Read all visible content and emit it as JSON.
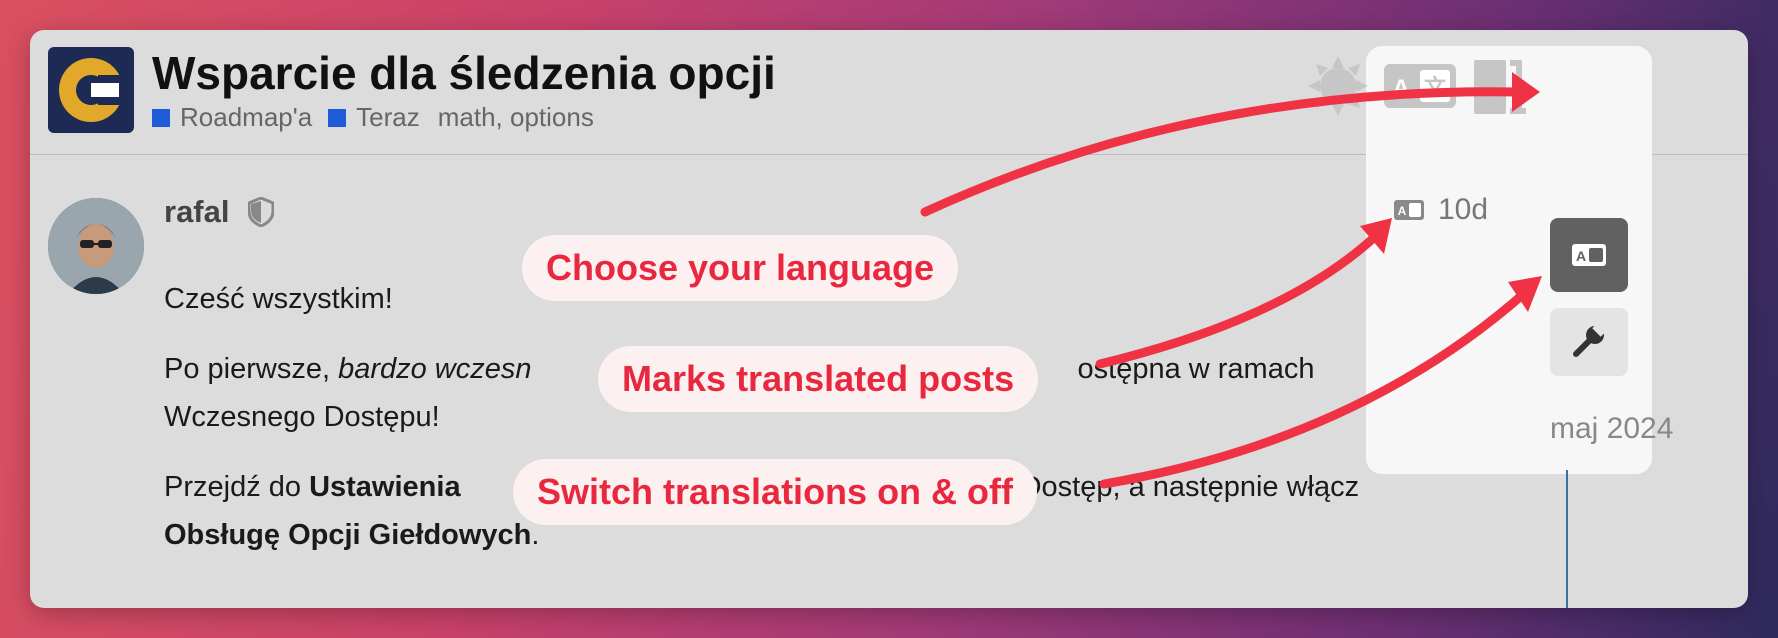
{
  "topic": {
    "title": "Wsparcie dla śledzenia opcji",
    "categories": [
      {
        "name": "Roadmap'a",
        "color": "#1f5bd6"
      },
      {
        "name": "Teraz",
        "color": "#1f5bd6"
      }
    ],
    "tags": "math, options"
  },
  "header_icons": [
    "sun-icon",
    "translate-icon",
    "logout-door-icon"
  ],
  "post": {
    "username": "rafal",
    "time": "10d",
    "greeting": "Cześć wszystkim!",
    "p2_prefix": "Po pierwsze, ",
    "p2_italic": "bardzo wczesn",
    "p2_suffix": "ostępna w ramach",
    "p2_line2": "Wczesnego Dostępu!",
    "p3_prefix": "Przejdź do ",
    "p3_bold": "Ustawienia",
    "p3_suffix": "Dostęp, a następnie włącz",
    "p3_bold2": "Obsługę Opcji Giełdowych",
    "p3_end": "."
  },
  "timeline": {
    "date": "maj 2024"
  },
  "annotations": {
    "language": "Choose your language",
    "marks": "Marks translated posts",
    "switch": "Switch translations on & off"
  },
  "colors": {
    "accent": "#e8283f",
    "category": "#1f5bd6",
    "panel": "#dcdcdc"
  }
}
